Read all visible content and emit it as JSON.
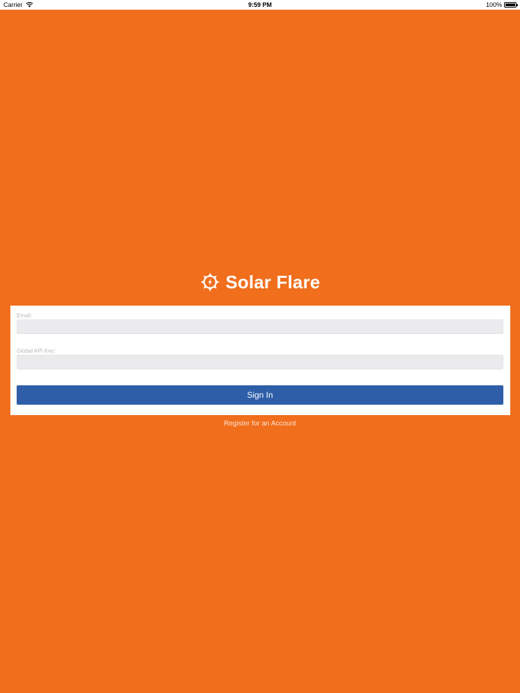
{
  "status_bar": {
    "carrier": "Carrier",
    "time": "9:59 PM",
    "battery": "100%",
    "battery_level": 1.0
  },
  "brand": {
    "name": "Solar Flare",
    "icon": "sun-gear-icon"
  },
  "login_form": {
    "email_label": "Email:",
    "email_value": "",
    "api_key_label": "Global API Key:",
    "api_key_value": "",
    "sign_in_label": "Sign In"
  },
  "register_label": "Register for an Account",
  "colors": {
    "background": "#f06e1c",
    "card": "#ffffff",
    "button": "#2e5ea8",
    "input": "#ebebed"
  }
}
